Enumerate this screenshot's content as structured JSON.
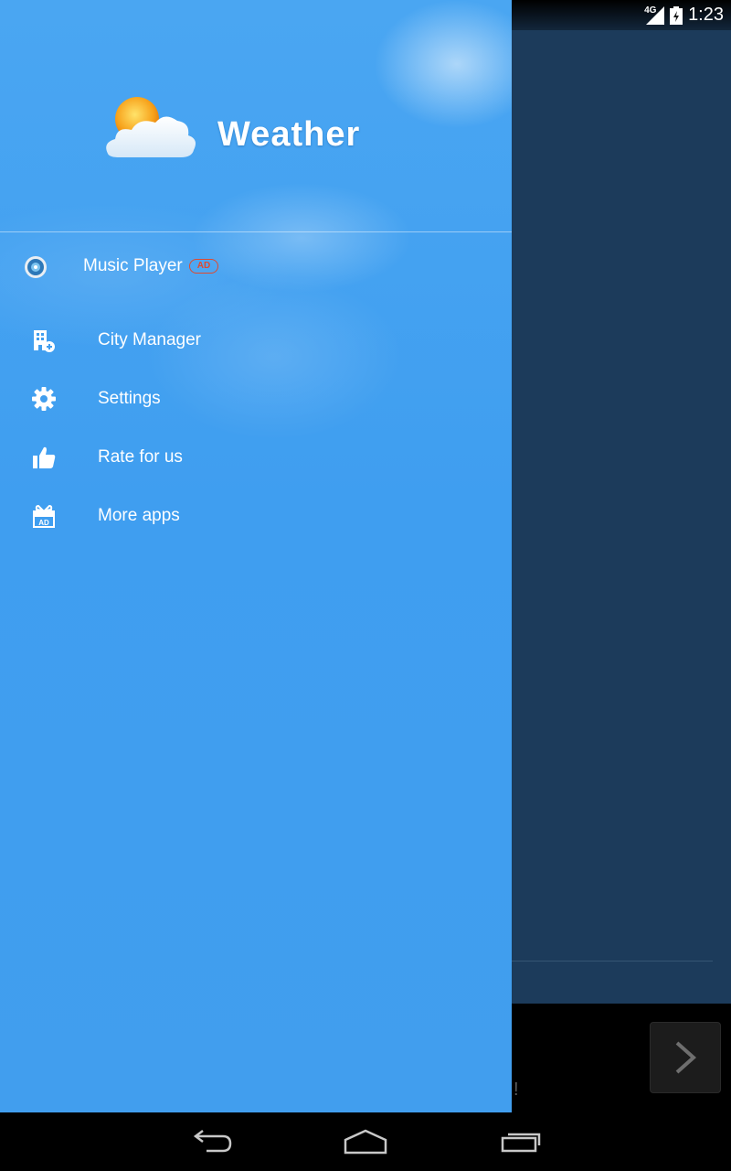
{
  "status_bar": {
    "network": "4G",
    "time": "1:23"
  },
  "drawer": {
    "app_title": "Weather",
    "ad_item": {
      "label": "Music Player",
      "badge": "AD"
    },
    "menu_items": [
      {
        "label": "City Manager",
        "icon": "city-add-icon"
      },
      {
        "label": "Settings",
        "icon": "gear-icon"
      },
      {
        "label": "Rate for us",
        "icon": "thumbs-up-icon"
      },
      {
        "label": "More apps",
        "icon": "gift-ad-icon"
      }
    ]
  },
  "background": {
    "ad_glyph": "!"
  },
  "colors": {
    "drawer_blue": "#419eee",
    "background_navy": "#1c3b5b",
    "ad_badge_red": "#e04a2e"
  }
}
